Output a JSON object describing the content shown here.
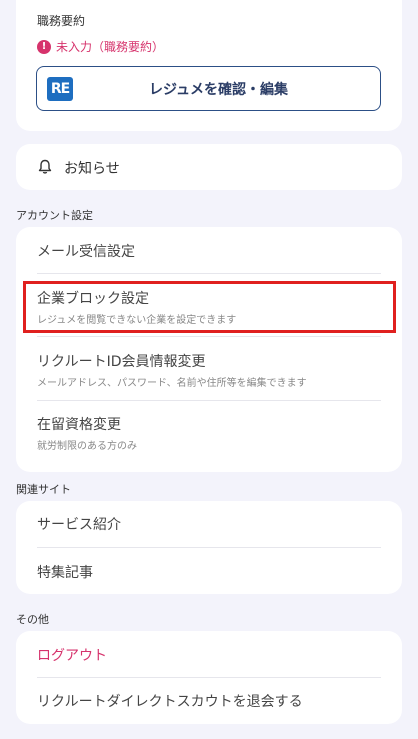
{
  "resume": {
    "section_title": "職務要約",
    "warning_text": "未入力（職務要約）",
    "button_label": "レジュメを確認・編集",
    "logo_text": "RE"
  },
  "notice": {
    "label": "お知らせ"
  },
  "account": {
    "group_label": "アカウント設定",
    "items": [
      {
        "title": "メール受信設定",
        "subtitle": ""
      },
      {
        "title": "企業ブロック設定",
        "subtitle": "レジュメを閲覧できない企業を設定できます"
      },
      {
        "title": "リクルートID会員情報変更",
        "subtitle": "メールアドレス、パスワード、名前や住所等を編集できます"
      },
      {
        "title": "在留資格変更",
        "subtitle": "就労制限のある方のみ"
      }
    ]
  },
  "related": {
    "group_label": "関連サイト",
    "items": [
      {
        "title": "サービス紹介"
      },
      {
        "title": "特集記事"
      }
    ]
  },
  "other": {
    "group_label": "その他",
    "items": [
      {
        "title": "ログアウト"
      },
      {
        "title": "リクルートダイレクトスカウトを退会する"
      }
    ]
  },
  "colors": {
    "accent_pink": "#d6336c",
    "highlight_red": "#e0201f",
    "brand_blue": "#1e6ec0"
  },
  "icons": {
    "warning": "exclamation-circle-icon",
    "notice": "bell-icon",
    "resume": "resume-logo-icon"
  }
}
